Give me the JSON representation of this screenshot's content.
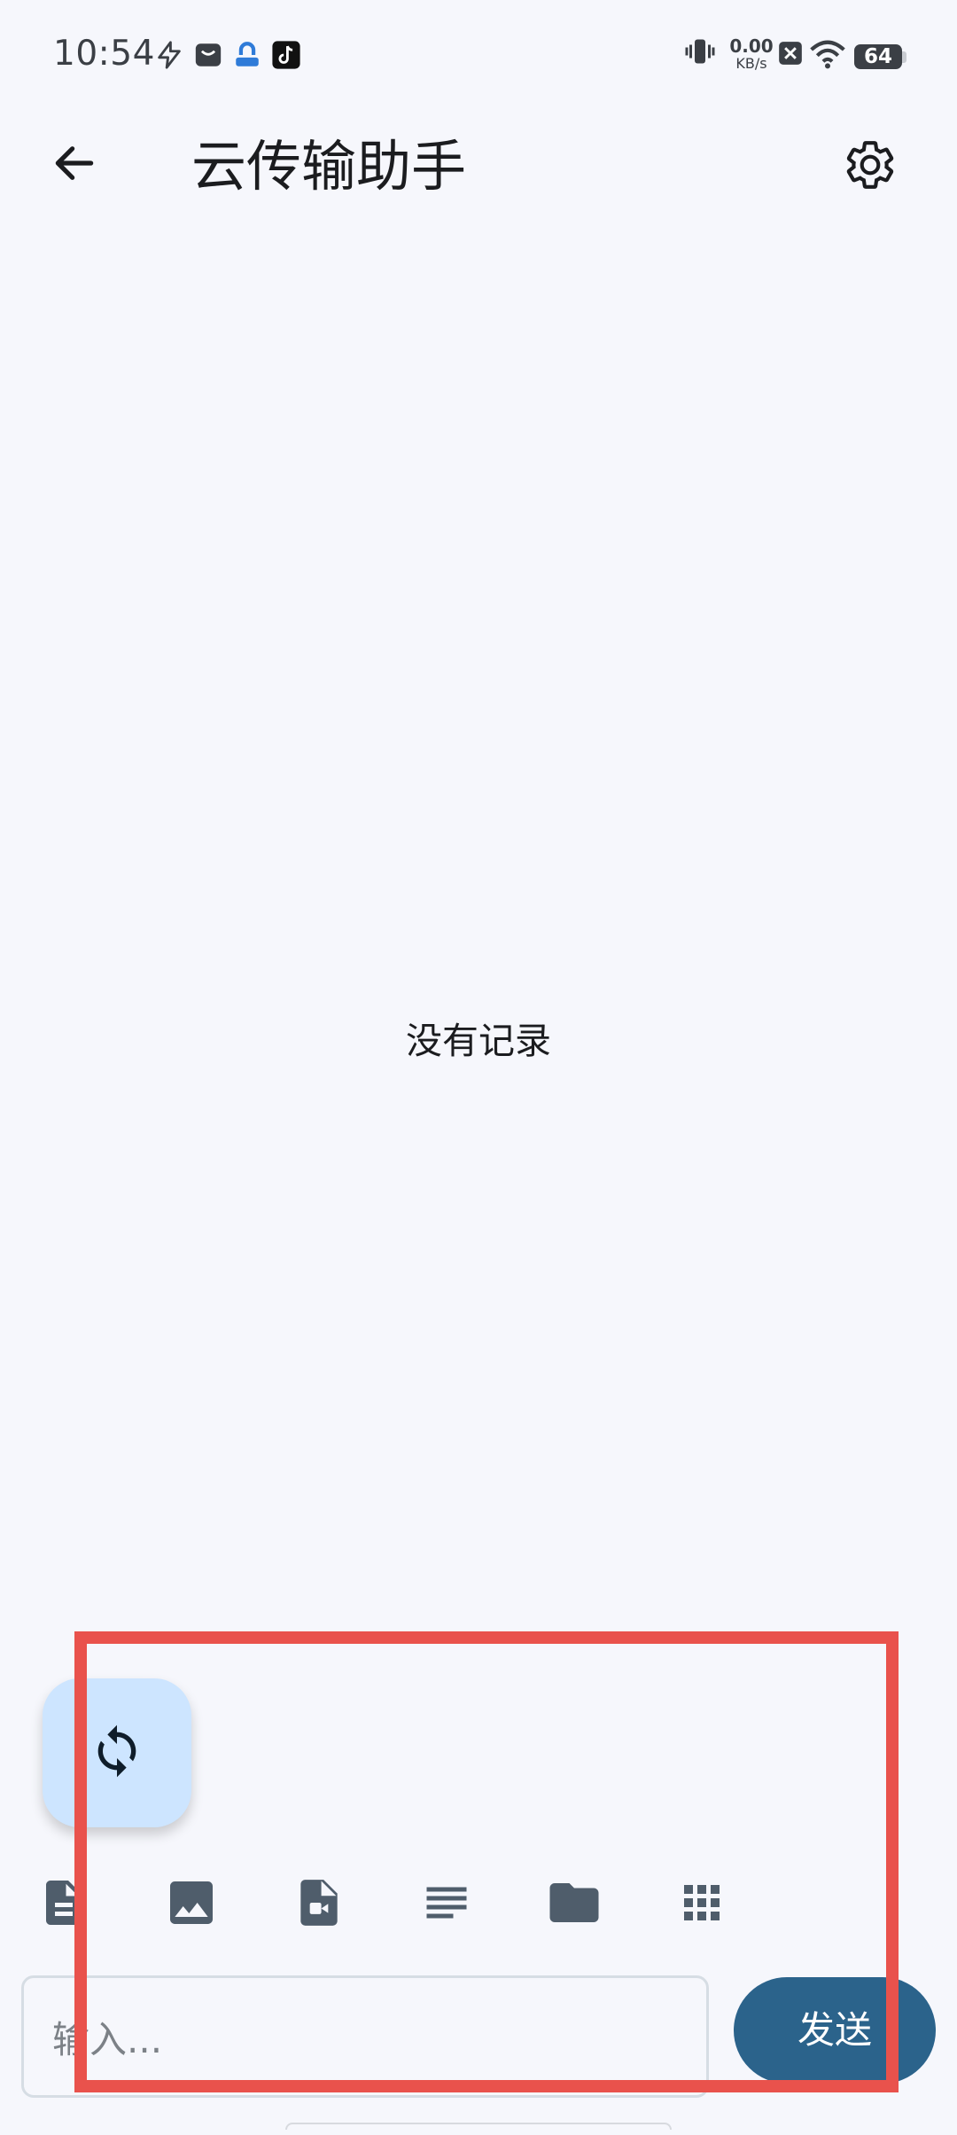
{
  "status_bar": {
    "time": "10:54",
    "net_speed_value": "0.00",
    "net_speed_unit": "KB/s",
    "battery": "64",
    "left_icons": [
      "flash-icon",
      "shopping-bag-icon",
      "app-badge-icon",
      "tiktok-icon"
    ],
    "right_icons": [
      "vibrate-icon",
      "no-sim-icon",
      "wifi-icon",
      "battery-icon"
    ]
  },
  "app_bar": {
    "back_icon": "arrow-back-icon",
    "title": "云传输助手",
    "settings_icon": "gear-icon"
  },
  "main": {
    "empty_text": "没有记录"
  },
  "fab": {
    "icon": "sync-icon"
  },
  "toolbar": {
    "items": [
      {
        "icon": "document-icon"
      },
      {
        "icon": "image-icon"
      },
      {
        "icon": "video-file-icon"
      },
      {
        "icon": "text-lines-icon"
      },
      {
        "icon": "folder-icon"
      },
      {
        "icon": "apps-grid-icon"
      }
    ]
  },
  "composer": {
    "input_placeholder": "输入...",
    "input_value": "",
    "send_label": "发送"
  },
  "colors": {
    "background": "#f6f7fc",
    "accent": "#2b638b",
    "fab": "#cde5ff",
    "icon": "#4f5d6b",
    "highlight": "#e9524c"
  }
}
